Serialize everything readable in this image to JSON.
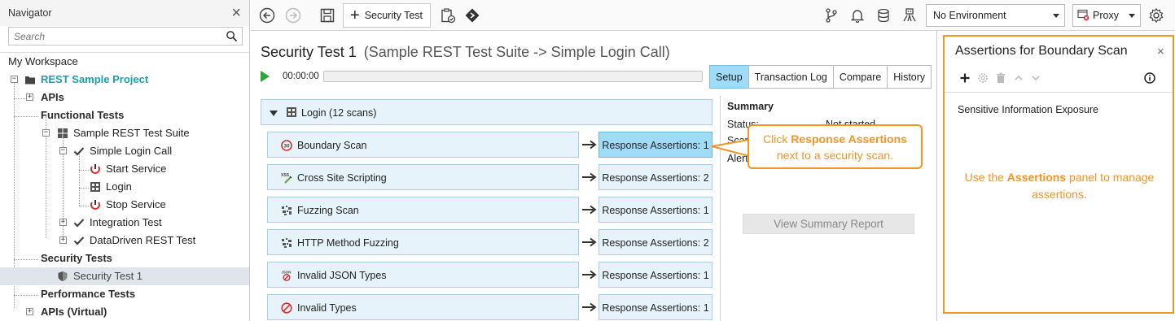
{
  "navigator": {
    "title": "Navigator",
    "close_label": "×",
    "search_placeholder": "Search",
    "workspace": "My Workspace",
    "tree": [
      {
        "label": "REST Sample Project"
      },
      {
        "label": "APIs"
      },
      {
        "label": "Functional Tests"
      },
      {
        "label": "Sample REST Test Suite"
      },
      {
        "label": "Simple Login Call"
      },
      {
        "label": "Start Service"
      },
      {
        "label": "Login"
      },
      {
        "label": "Stop Service"
      },
      {
        "label": "Integration Test"
      },
      {
        "label": "DataDriven REST Test"
      },
      {
        "label": "Security Tests"
      },
      {
        "label": "Security Test 1"
      },
      {
        "label": "Performance Tests"
      },
      {
        "label": "APIs (Virtual)"
      }
    ]
  },
  "toolbar": {
    "new_button_label": "Security Test",
    "environment": "No Environment",
    "proxy": "Proxy"
  },
  "main": {
    "title": "Security Test 1",
    "subtitle": "(Sample REST Test Suite -> Simple Login Call)",
    "timer": "00:00:00",
    "progress": 0,
    "tabs": [
      {
        "label": "Setup",
        "active": true
      },
      {
        "label": "Transaction Log"
      },
      {
        "label": "Compare"
      },
      {
        "label": "History"
      }
    ],
    "group_label": "Login (12 scans)",
    "scans": [
      {
        "name": "Boundary Scan",
        "icon": "boundary-scan-icon",
        "assertions": "Response Assertions: 1",
        "active": true
      },
      {
        "name": "Cross Site Scripting",
        "icon": "xss-icon",
        "assertions": "Response Assertions: 2"
      },
      {
        "name": "Fuzzing Scan",
        "icon": "fuzzing-icon",
        "assertions": "Response Assertions: 1"
      },
      {
        "name": "HTTP Method Fuzzing",
        "icon": "fuzzing-icon",
        "assertions": "Response Assertions: 2"
      },
      {
        "name": "Invalid JSON Types",
        "icon": "json-icon",
        "assertions": "Response Assertions: 1"
      },
      {
        "name": "Invalid Types",
        "icon": "invalid-types-icon",
        "assertions": "Response Assertions: 1"
      }
    ]
  },
  "summary": {
    "title": "Summary",
    "status_key": "Status:",
    "status_value": "Not started",
    "scans_key": "Scans:",
    "alerts_key": "Alerts:",
    "report_button": "View Summary Report"
  },
  "callout": {
    "prefix": "Click ",
    "bold": "Response Assertions",
    "suffix": "next to a security scan."
  },
  "assertions_panel": {
    "title": "Assertions for Boundary Scan",
    "close_label": "×",
    "item": "Sensitive Information Exposure",
    "note_prefix": "Use the ",
    "note_bold": "Assertions",
    "note_suffix": " panel to manage assertions."
  },
  "colors": {
    "accent_orange": "#f39425",
    "active_blue": "#9fdcf7",
    "scan_bg": "#e7f3fa",
    "teal": "#1aa0a8"
  }
}
